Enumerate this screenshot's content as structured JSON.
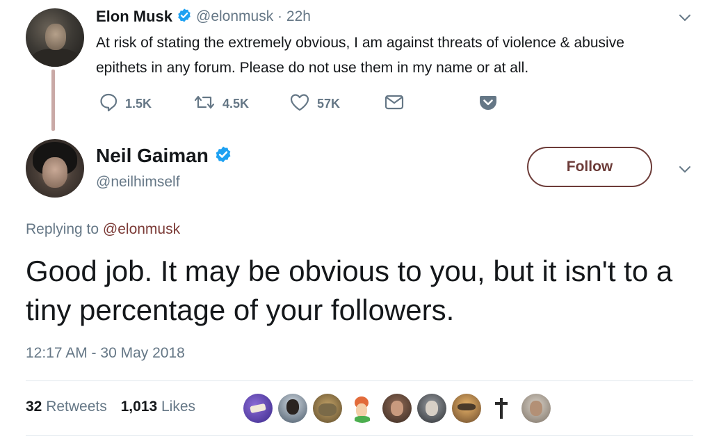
{
  "parent_tweet": {
    "author_name": "Elon Musk",
    "author_handle": "@elonmusk",
    "time_sep": " · ",
    "time_ago": "22h",
    "text": "At risk of stating the extremely obvious, I am against threats of violence & abusive epithets in any forum. Please do not use them in my name or at all.",
    "actions": {
      "replies": "1.5K",
      "retweets": "4.5K",
      "likes": "57K"
    }
  },
  "reply_tweet": {
    "author_name": "Neil Gaiman",
    "author_handle": "@neilhimself",
    "follow_label": "Follow",
    "replying_prefix": "Replying to ",
    "replying_to": "@elonmusk",
    "text": "Good job. It may be obvious to you, but it isn't to a tiny percentage of your followers.",
    "timestamp": "12:17 AM - 30 May 2018",
    "retweet_count": "32",
    "retweet_label": "Retweets",
    "like_count": "1,013",
    "like_label": "Likes",
    "liker_avatar_count": 9
  },
  "colors": {
    "accent": "#6c3b38",
    "verified": "#1da1f2",
    "secondary_text": "#657786",
    "thread_line": "#c9a9a6"
  },
  "icons": {
    "verified": "verified-badge-icon",
    "reply": "reply-icon",
    "retweet": "retweet-icon",
    "like": "heart-icon",
    "dm": "envelope-icon",
    "pocket": "pocket-icon",
    "more": "chevron-down-icon"
  }
}
